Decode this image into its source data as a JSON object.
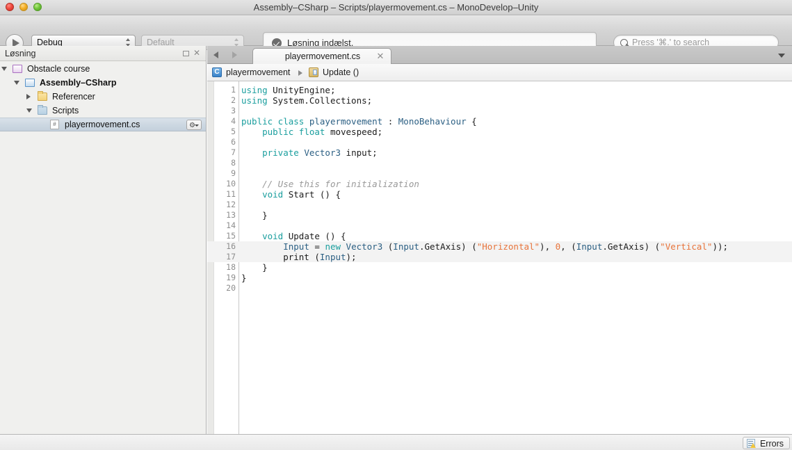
{
  "window": {
    "title": "Assembly–CSharp – Scripts/playermovement.cs – MonoDevelop–Unity"
  },
  "toolbar": {
    "run_label": "run-button",
    "configuration": "Debug",
    "runtime": "Default",
    "status_message": "Løsning indælst.",
    "search_placeholder": "Press '⌘.' to search"
  },
  "sidebar": {
    "title": "Løsning",
    "tree": [
      {
        "label": "Obstacle course",
        "icon": "solution",
        "indent": 18,
        "twisty": "open",
        "bold": false,
        "selected": false,
        "gear": false
      },
      {
        "label": "Assembly–CSharp",
        "icon": "project",
        "indent": 36,
        "twisty": "open",
        "bold": true,
        "selected": false,
        "gear": false
      },
      {
        "label": "Referencer",
        "icon": "folder-ref",
        "indent": 54,
        "twisty": "closed",
        "bold": false,
        "selected": false,
        "gear": false
      },
      {
        "label": "Scripts",
        "icon": "folder-scripts",
        "indent": 54,
        "twisty": "open",
        "bold": false,
        "selected": false,
        "gear": false
      },
      {
        "label": "playermovement.cs",
        "icon": "file-cs",
        "indent": 72,
        "twisty": "none",
        "bold": false,
        "selected": true,
        "gear": true
      }
    ]
  },
  "editor": {
    "tab": {
      "label": "playermovement.cs",
      "close": "✕"
    },
    "breadcrumb": {
      "class_icon_text": "C",
      "class_name": "playermovement",
      "member_name": "Update ()"
    },
    "file_icon_glyph": "#",
    "lines": [
      {
        "n": "1",
        "tokens": [
          {
            "t": "using ",
            "c": "k"
          },
          {
            "t": "UnityEngine;",
            "c": "pl"
          }
        ]
      },
      {
        "n": "2",
        "tokens": [
          {
            "t": "using ",
            "c": "k"
          },
          {
            "t": "System.Collections;",
            "c": "pl"
          }
        ]
      },
      {
        "n": "3",
        "tokens": []
      },
      {
        "n": "4",
        "tokens": [
          {
            "t": "public class ",
            "c": "k"
          },
          {
            "t": "playermovement",
            "c": "ty"
          },
          {
            "t": " : ",
            "c": "pl"
          },
          {
            "t": "MonoBehaviour",
            "c": "ty"
          },
          {
            "t": " {",
            "c": "pl"
          }
        ]
      },
      {
        "n": "5",
        "tokens": [
          {
            "t": "    ",
            "c": "pl"
          },
          {
            "t": "public float ",
            "c": "k"
          },
          {
            "t": "movespeed;",
            "c": "pl"
          }
        ]
      },
      {
        "n": "6",
        "tokens": []
      },
      {
        "n": "7",
        "tokens": [
          {
            "t": "    ",
            "c": "pl"
          },
          {
            "t": "private ",
            "c": "k"
          },
          {
            "t": "Vector3",
            "c": "ty"
          },
          {
            "t": " input;",
            "c": "pl"
          }
        ]
      },
      {
        "n": "8",
        "tokens": []
      },
      {
        "n": "9",
        "tokens": []
      },
      {
        "n": "10",
        "tokens": [
          {
            "t": "    ",
            "c": "pl"
          },
          {
            "t": "// Use this for initialization",
            "c": "cm"
          }
        ]
      },
      {
        "n": "11",
        "tokens": [
          {
            "t": "    ",
            "c": "pl"
          },
          {
            "t": "void ",
            "c": "k"
          },
          {
            "t": "Start () {",
            "c": "pl"
          }
        ]
      },
      {
        "n": "12",
        "tokens": []
      },
      {
        "n": "13",
        "tokens": [
          {
            "t": "    }",
            "c": "pl"
          }
        ]
      },
      {
        "n": "14",
        "tokens": []
      },
      {
        "n": "15",
        "tokens": [
          {
            "t": "    ",
            "c": "pl"
          },
          {
            "t": "void ",
            "c": "k"
          },
          {
            "t": "Update () {",
            "c": "pl"
          }
        ]
      },
      {
        "n": "16",
        "current": true,
        "tokens": [
          {
            "t": "        ",
            "c": "pl"
          },
          {
            "t": "Input",
            "c": "ty"
          },
          {
            "t": " = ",
            "c": "pl"
          },
          {
            "t": "new ",
            "c": "k"
          },
          {
            "t": "Vector3",
            "c": "ty"
          },
          {
            "t": " (",
            "c": "pl"
          },
          {
            "t": "Input",
            "c": "ty"
          },
          {
            "t": ".GetAxis) (",
            "c": "pl"
          },
          {
            "t": "\"Horizontal\"",
            "c": "st"
          },
          {
            "t": "), ",
            "c": "pl"
          },
          {
            "t": "0",
            "c": "nu"
          },
          {
            "t": ", (",
            "c": "pl"
          },
          {
            "t": "Input",
            "c": "ty"
          },
          {
            "t": ".GetAxis) (",
            "c": "pl"
          },
          {
            "t": "\"Vertical\"",
            "c": "st"
          },
          {
            "t": "));",
            "c": "pl"
          }
        ]
      },
      {
        "n": "17",
        "current": true,
        "tokens": [
          {
            "t": "        print (",
            "c": "pl"
          },
          {
            "t": "Input",
            "c": "ty"
          },
          {
            "t": ");",
            "c": "pl"
          }
        ]
      },
      {
        "n": "18",
        "tokens": [
          {
            "t": "    }",
            "c": "pl"
          }
        ]
      },
      {
        "n": "19",
        "tokens": [
          {
            "t": "}",
            "c": "pl"
          }
        ]
      },
      {
        "n": "20",
        "tokens": []
      }
    ]
  },
  "statusbar": {
    "errors_label": "Errors"
  },
  "colors": {
    "keyword": "#1a9e9e",
    "type": "#2b5f83",
    "string": "#e8743b",
    "comment": "#999999",
    "selection": "#cdd8e2"
  }
}
